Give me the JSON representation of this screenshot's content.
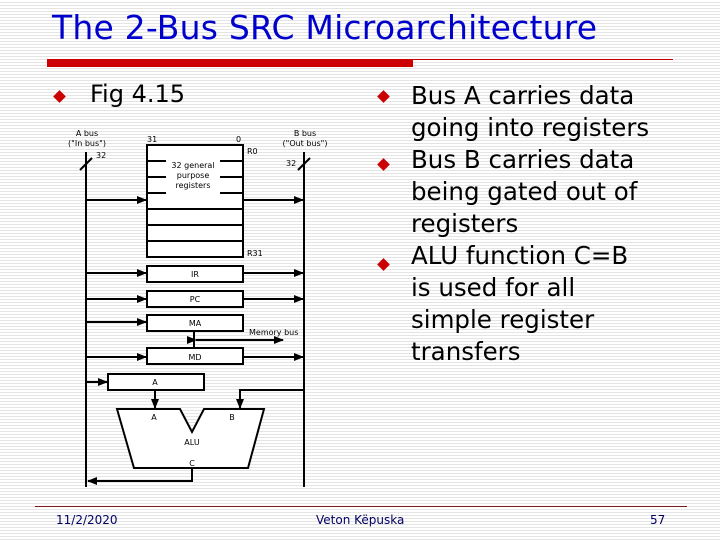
{
  "slide": {
    "title": "The 2-Bus SRC Microarchitecture",
    "left_bullet": "Fig 4.15",
    "right_bullets": [
      {
        "lines": [
          "Bus A carries data",
          "going into registers"
        ]
      },
      {
        "lines": [
          "Bus B carries data",
          "being gated out of",
          "registers"
        ]
      },
      {
        "lines": [
          "ALU function C=B",
          "is used for all",
          "simple register",
          "transfers"
        ]
      }
    ],
    "accent_color": "#cc0000",
    "title_color": "#0000cc"
  },
  "diagram": {
    "a_bus_label": "A bus",
    "a_bus_sublabel": "(\"In bus\")",
    "a_bus_width": "32",
    "b_bus_label": "B bus",
    "b_bus_sublabel": "(\"Out bus\")",
    "b_bus_width": "32",
    "reg_msb": "31",
    "reg_lsb": "0",
    "reg_first": "R0",
    "reg_last": "R31",
    "reg_file_label": [
      "32 general",
      "purpose",
      "registers"
    ],
    "registers": [
      "IR",
      "PC",
      "MA",
      "MD"
    ],
    "memory_bus_label": "Memory bus",
    "a_register": "A",
    "alu_input_a": "A",
    "alu_input_b": "B",
    "alu_label": "ALU",
    "alu_output": "C"
  },
  "footer": {
    "date": "11/2/2020",
    "author": "Veton Këpuska",
    "page": "57"
  }
}
